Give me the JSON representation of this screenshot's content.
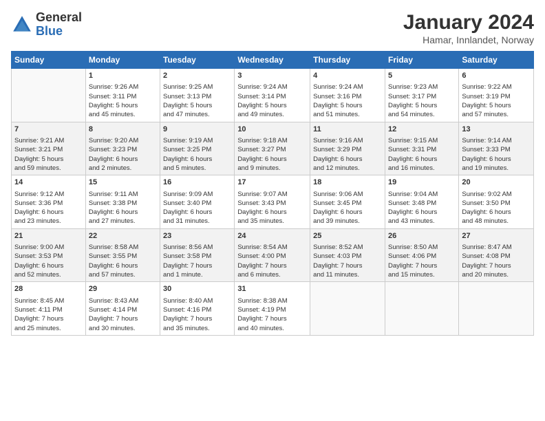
{
  "header": {
    "logo_general": "General",
    "logo_blue": "Blue",
    "title": "January 2024",
    "subtitle": "Hamar, Innlandet, Norway"
  },
  "weekdays": [
    "Sunday",
    "Monday",
    "Tuesday",
    "Wednesday",
    "Thursday",
    "Friday",
    "Saturday"
  ],
  "weeks": [
    [
      {
        "day": "",
        "content": ""
      },
      {
        "day": "1",
        "content": "Sunrise: 9:26 AM\nSunset: 3:11 PM\nDaylight: 5 hours\nand 45 minutes."
      },
      {
        "day": "2",
        "content": "Sunrise: 9:25 AM\nSunset: 3:13 PM\nDaylight: 5 hours\nand 47 minutes."
      },
      {
        "day": "3",
        "content": "Sunrise: 9:24 AM\nSunset: 3:14 PM\nDaylight: 5 hours\nand 49 minutes."
      },
      {
        "day": "4",
        "content": "Sunrise: 9:24 AM\nSunset: 3:16 PM\nDaylight: 5 hours\nand 51 minutes."
      },
      {
        "day": "5",
        "content": "Sunrise: 9:23 AM\nSunset: 3:17 PM\nDaylight: 5 hours\nand 54 minutes."
      },
      {
        "day": "6",
        "content": "Sunrise: 9:22 AM\nSunset: 3:19 PM\nDaylight: 5 hours\nand 57 minutes."
      }
    ],
    [
      {
        "day": "7",
        "content": "Sunrise: 9:21 AM\nSunset: 3:21 PM\nDaylight: 5 hours\nand 59 minutes."
      },
      {
        "day": "8",
        "content": "Sunrise: 9:20 AM\nSunset: 3:23 PM\nDaylight: 6 hours\nand 2 minutes."
      },
      {
        "day": "9",
        "content": "Sunrise: 9:19 AM\nSunset: 3:25 PM\nDaylight: 6 hours\nand 5 minutes."
      },
      {
        "day": "10",
        "content": "Sunrise: 9:18 AM\nSunset: 3:27 PM\nDaylight: 6 hours\nand 9 minutes."
      },
      {
        "day": "11",
        "content": "Sunrise: 9:16 AM\nSunset: 3:29 PM\nDaylight: 6 hours\nand 12 minutes."
      },
      {
        "day": "12",
        "content": "Sunrise: 9:15 AM\nSunset: 3:31 PM\nDaylight: 6 hours\nand 16 minutes."
      },
      {
        "day": "13",
        "content": "Sunrise: 9:14 AM\nSunset: 3:33 PM\nDaylight: 6 hours\nand 19 minutes."
      }
    ],
    [
      {
        "day": "14",
        "content": "Sunrise: 9:12 AM\nSunset: 3:36 PM\nDaylight: 6 hours\nand 23 minutes."
      },
      {
        "day": "15",
        "content": "Sunrise: 9:11 AM\nSunset: 3:38 PM\nDaylight: 6 hours\nand 27 minutes."
      },
      {
        "day": "16",
        "content": "Sunrise: 9:09 AM\nSunset: 3:40 PM\nDaylight: 6 hours\nand 31 minutes."
      },
      {
        "day": "17",
        "content": "Sunrise: 9:07 AM\nSunset: 3:43 PM\nDaylight: 6 hours\nand 35 minutes."
      },
      {
        "day": "18",
        "content": "Sunrise: 9:06 AM\nSunset: 3:45 PM\nDaylight: 6 hours\nand 39 minutes."
      },
      {
        "day": "19",
        "content": "Sunrise: 9:04 AM\nSunset: 3:48 PM\nDaylight: 6 hours\nand 43 minutes."
      },
      {
        "day": "20",
        "content": "Sunrise: 9:02 AM\nSunset: 3:50 PM\nDaylight: 6 hours\nand 48 minutes."
      }
    ],
    [
      {
        "day": "21",
        "content": "Sunrise: 9:00 AM\nSunset: 3:53 PM\nDaylight: 6 hours\nand 52 minutes."
      },
      {
        "day": "22",
        "content": "Sunrise: 8:58 AM\nSunset: 3:55 PM\nDaylight: 6 hours\nand 57 minutes."
      },
      {
        "day": "23",
        "content": "Sunrise: 8:56 AM\nSunset: 3:58 PM\nDaylight: 7 hours\nand 1 minute."
      },
      {
        "day": "24",
        "content": "Sunrise: 8:54 AM\nSunset: 4:00 PM\nDaylight: 7 hours\nand 6 minutes."
      },
      {
        "day": "25",
        "content": "Sunrise: 8:52 AM\nSunset: 4:03 PM\nDaylight: 7 hours\nand 11 minutes."
      },
      {
        "day": "26",
        "content": "Sunrise: 8:50 AM\nSunset: 4:06 PM\nDaylight: 7 hours\nand 15 minutes."
      },
      {
        "day": "27",
        "content": "Sunrise: 8:47 AM\nSunset: 4:08 PM\nDaylight: 7 hours\nand 20 minutes."
      }
    ],
    [
      {
        "day": "28",
        "content": "Sunrise: 8:45 AM\nSunset: 4:11 PM\nDaylight: 7 hours\nand 25 minutes."
      },
      {
        "day": "29",
        "content": "Sunrise: 8:43 AM\nSunset: 4:14 PM\nDaylight: 7 hours\nand 30 minutes."
      },
      {
        "day": "30",
        "content": "Sunrise: 8:40 AM\nSunset: 4:16 PM\nDaylight: 7 hours\nand 35 minutes."
      },
      {
        "day": "31",
        "content": "Sunrise: 8:38 AM\nSunset: 4:19 PM\nDaylight: 7 hours\nand 40 minutes."
      },
      {
        "day": "",
        "content": ""
      },
      {
        "day": "",
        "content": ""
      },
      {
        "day": "",
        "content": ""
      }
    ]
  ]
}
